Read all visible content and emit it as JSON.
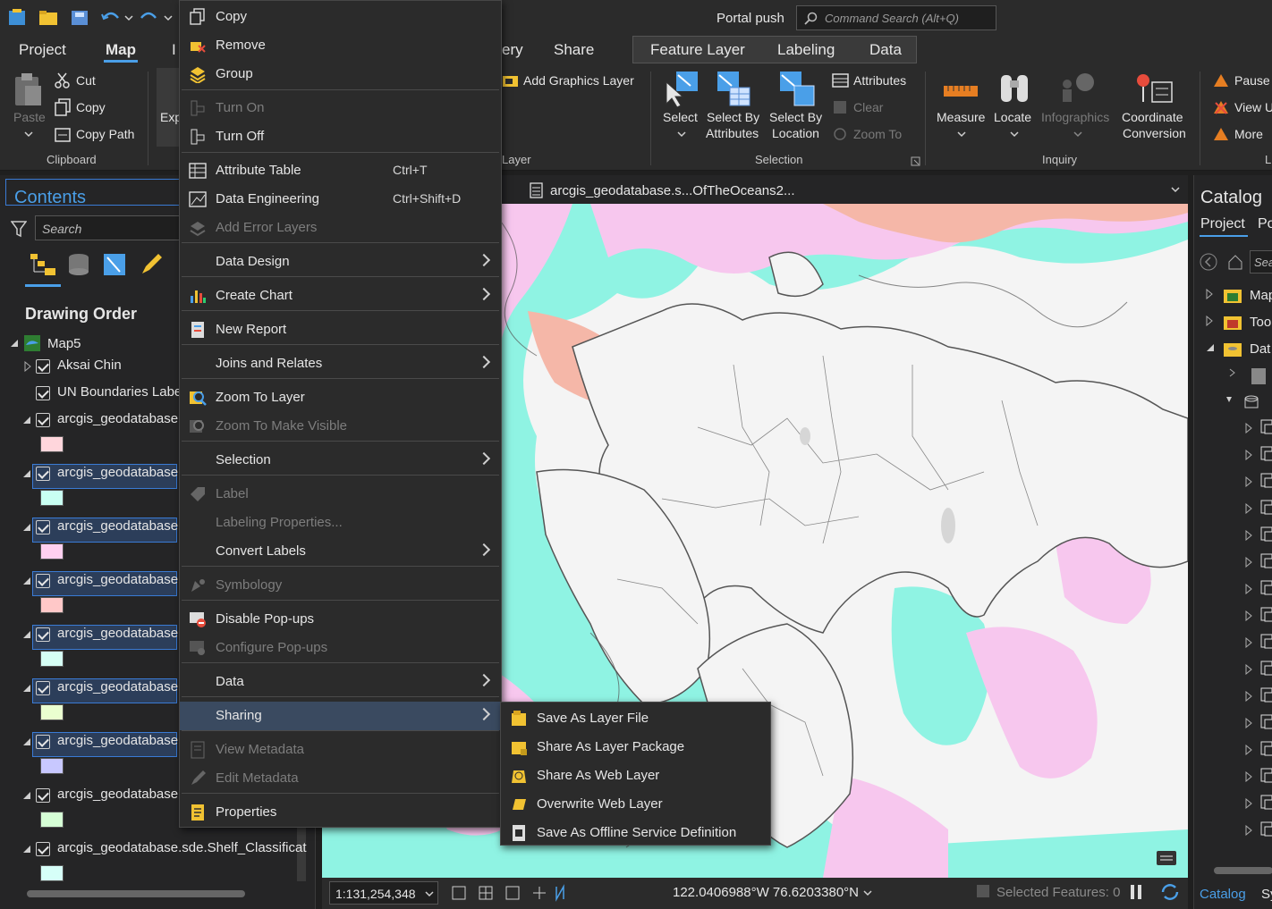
{
  "titlebar": {
    "portal": "Portal push",
    "search_placeholder": "Command Search (Alt+Q)"
  },
  "ribbon_tabs": [
    {
      "label": "Project"
    },
    {
      "label": "Map"
    },
    {
      "label": "I"
    },
    {
      "label": "ery"
    },
    {
      "label": "Share"
    },
    {
      "label": "Feature Layer"
    },
    {
      "label": "Labeling"
    },
    {
      "label": "Data"
    }
  ],
  "ribbon": {
    "paste": "Paste",
    "cut": "Cut",
    "copy": "Copy",
    "copy_path": "Copy Path",
    "clipboard_group": "Clipboard",
    "exp": "Exp",
    "add_graphics_layer": "Add Graphics Layer",
    "layer_group": "Layer",
    "select": "Select",
    "select_by_attributes_1": "Select By",
    "select_by_attributes_2": "Attributes",
    "select_by_location_1": "Select By",
    "select_by_location_2": "Location",
    "attributes": "Attributes",
    "clear": "Clear",
    "zoom_to": "Zoom To",
    "selection_group": "Selection",
    "measure": "Measure",
    "locate": "Locate",
    "infographics": "Infographics",
    "coord_1": "Coordinate",
    "coord_2": "Conversion",
    "inquiry_group": "Inquiry",
    "pause": "Pause",
    "view_u": "View U",
    "more": "More",
    "l_group": "L"
  },
  "contents": {
    "title": "Contents",
    "search_placeholder": "Search",
    "drawing_order": "Drawing Order",
    "map_name": "Map5",
    "layers": [
      {
        "name": "Aksai Chin",
        "selected": false,
        "swatch": null
      },
      {
        "name": "UN Boundaries Labe",
        "selected": false,
        "swatch": null
      },
      {
        "name": "arcgis_geodatabase.",
        "selected": false,
        "swatch": "#ffd6dc"
      },
      {
        "name": "arcgis_geodatabase.",
        "selected": true,
        "swatch": "#c9fff2"
      },
      {
        "name": "arcgis_geodatabase.",
        "selected": true,
        "swatch": "#ffd0f0"
      },
      {
        "name": "arcgis_geodatabase.",
        "selected": true,
        "swatch": "#ffc8c8"
      },
      {
        "name": "arcgis_geodatabase.",
        "selected": true,
        "swatch": "#d6fff5"
      },
      {
        "name": "arcgis_geodatabase.",
        "selected": true,
        "swatch": "#eaffd0"
      },
      {
        "name": "arcgis_geodatabase.",
        "selected": true,
        "swatch": "#c8c8ff"
      },
      {
        "name": "arcgis_geodatabase.",
        "selected": false,
        "swatch": "#d6ffd6"
      },
      {
        "name": "arcgis_geodatabase.sde.Shelf_Classificat",
        "selected": false,
        "swatch": "#d6fff8"
      }
    ]
  },
  "map": {
    "tab_title": "arcgis_geodatabase.s...OfTheOceans2...",
    "scale": "1:131,254,348",
    "coords": "122.0406988°W 76.6203380°N",
    "selected_features": "Selected Features: 0"
  },
  "catalog": {
    "title": "Catalog",
    "tab_project": "Project",
    "tab_po": "Po",
    "search": "Sea",
    "items": [
      "Map",
      "Too",
      "Dat"
    ],
    "bottom_tab": "Catalog",
    "bottom_tab2": "Sy"
  },
  "context_menu": {
    "items": [
      {
        "label": "Copy",
        "disabled": false,
        "shortcut": "",
        "submenu": false
      },
      {
        "label": "Remove",
        "disabled": false,
        "shortcut": "",
        "submenu": false
      },
      {
        "label": "Group",
        "disabled": false,
        "shortcut": "",
        "submenu": false
      },
      {
        "label": "Turn On",
        "disabled": true,
        "shortcut": "",
        "submenu": false
      },
      {
        "label": "Turn Off",
        "disabled": false,
        "shortcut": "",
        "submenu": false
      },
      {
        "label": "Attribute Table",
        "disabled": false,
        "shortcut": "Ctrl+T",
        "submenu": false
      },
      {
        "label": "Data Engineering",
        "disabled": false,
        "shortcut": "Ctrl+Shift+D",
        "submenu": false
      },
      {
        "label": "Add Error Layers",
        "disabled": true,
        "shortcut": "",
        "submenu": false
      },
      {
        "label": "Data Design",
        "disabled": false,
        "shortcut": "",
        "submenu": true
      },
      {
        "label": "Create Chart",
        "disabled": false,
        "shortcut": "",
        "submenu": true
      },
      {
        "label": "New Report",
        "disabled": false,
        "shortcut": "",
        "submenu": false
      },
      {
        "label": "Joins and Relates",
        "disabled": false,
        "shortcut": "",
        "submenu": true
      },
      {
        "label": "Zoom To Layer",
        "disabled": false,
        "shortcut": "",
        "submenu": false
      },
      {
        "label": "Zoom To Make Visible",
        "disabled": true,
        "shortcut": "",
        "submenu": false
      },
      {
        "label": "Selection",
        "disabled": false,
        "shortcut": "",
        "submenu": true
      },
      {
        "label": "Label",
        "disabled": true,
        "shortcut": "",
        "submenu": false
      },
      {
        "label": "Labeling Properties...",
        "disabled": true,
        "shortcut": "",
        "submenu": false
      },
      {
        "label": "Convert Labels",
        "disabled": false,
        "shortcut": "",
        "submenu": true
      },
      {
        "label": "Symbology",
        "disabled": true,
        "shortcut": "",
        "submenu": false
      },
      {
        "label": "Disable Pop-ups",
        "disabled": false,
        "shortcut": "",
        "submenu": false
      },
      {
        "label": "Configure Pop-ups",
        "disabled": true,
        "shortcut": "",
        "submenu": false
      },
      {
        "label": "Data",
        "disabled": false,
        "shortcut": "",
        "submenu": true
      },
      {
        "label": "Sharing",
        "disabled": false,
        "shortcut": "",
        "submenu": true,
        "highlighted": true
      },
      {
        "label": "View Metadata",
        "disabled": true,
        "shortcut": "",
        "submenu": false
      },
      {
        "label": "Edit Metadata",
        "disabled": true,
        "shortcut": "",
        "submenu": false
      },
      {
        "label": "Properties",
        "disabled": false,
        "shortcut": "",
        "submenu": false
      }
    ]
  },
  "sharing_submenu": {
    "items": [
      {
        "label": "Save As Layer File"
      },
      {
        "label": "Share As Layer Package"
      },
      {
        "label": "Share As Web Layer"
      },
      {
        "label": "Overwrite Web Layer"
      },
      {
        "label": "Save As Offline Service Definition"
      }
    ]
  },
  "colors": {
    "accent": "#4a9fe8",
    "ocean_cyan": "#8ff3e3",
    "ocean_pink": "#f7c7ee",
    "salmon": "#f5b7a8",
    "land": "#f4f4f4",
    "outline": "#555555",
    "menu_highlight": "#3a4a60"
  }
}
